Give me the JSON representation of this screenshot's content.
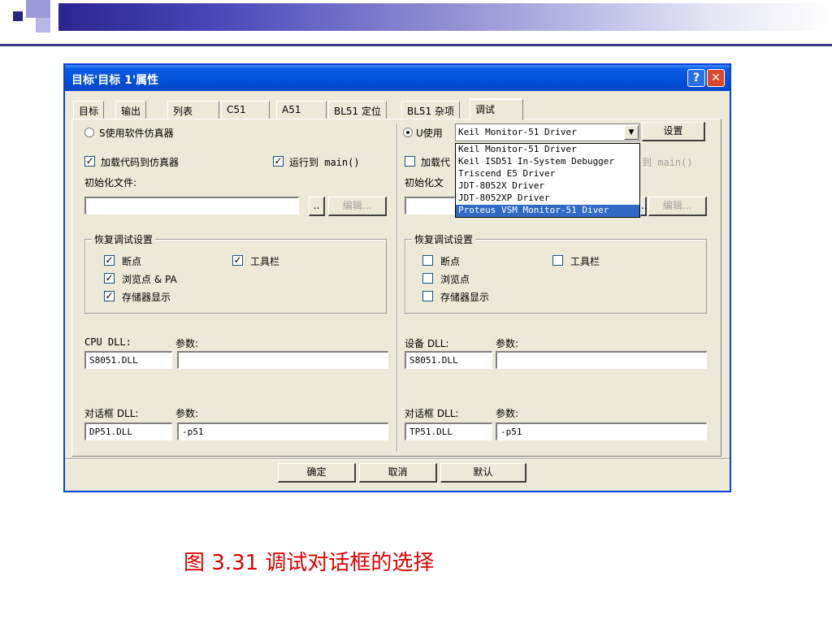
{
  "dialog": {
    "title": "目标'目标 1'属性",
    "help_label": "?",
    "close_label": "✕"
  },
  "tabs": [
    {
      "label": "目标"
    },
    {
      "label": "输出"
    },
    {
      "label": "列表"
    },
    {
      "label": "C51"
    },
    {
      "label": "A51"
    },
    {
      "label": "BL51 定位"
    },
    {
      "label": "BL51 杂项"
    },
    {
      "label": "调试",
      "active": true
    }
  ],
  "left": {
    "use_simulator_label": "S使用软件仿真器",
    "use_simulator_checked": false,
    "load_code_label": "加载代码到仿真器",
    "load_code_checked": true,
    "run_to_main_label": "运行到 main()",
    "run_to_main_checked": true,
    "init_file_label": "初始化文件:",
    "init_file_value": "",
    "browse_label": "..",
    "edit_label": "编辑...",
    "restore_group_title": "恢复调试设置",
    "restore": {
      "breakpoints": {
        "label": "断点",
        "checked": true
      },
      "toolbar": {
        "label": "工具栏",
        "checked": true
      },
      "watchpoints": {
        "label": "浏览点 & PA",
        "checked": true
      },
      "memory": {
        "label": "存储器显示",
        "checked": true
      }
    },
    "cpu_dll_label": "CPU DLL:",
    "cpu_param_label": "参数:",
    "cpu_dll_value": "S8051.DLL",
    "cpu_param_value": "",
    "dialog_dll_label": "对话框 DLL:",
    "dialog_param_label": "参数:",
    "dialog_dll_value": "DP51.DLL",
    "dialog_param_value": "-p51"
  },
  "right": {
    "use_label": "U使用",
    "use_checked": true,
    "driver_selected": "Keil Monitor-51 Driver",
    "settings_label": "设置",
    "load_code_label": "加载代",
    "load_code_checked": false,
    "run_to_main_label": "到 main()",
    "init_file_label": "初始化文",
    "init_file_value": "",
    "browse_label": "..",
    "edit_label": "编辑...",
    "restore_group_title": "恢复调试设置",
    "restore": {
      "breakpoints": {
        "label": "断点",
        "checked": false
      },
      "toolbar": {
        "label": "工具栏",
        "checked": false
      },
      "watchpoints": {
        "label": "浏览点",
        "checked": false
      },
      "memory": {
        "label": "存储器显示",
        "checked": false
      }
    },
    "device_dll_label": "设备 DLL:",
    "device_param_label": "参数:",
    "device_dll_value": "S8051.DLL",
    "device_param_value": "",
    "dialog_dll_label": "对话框 DLL:",
    "dialog_param_label": "参数:",
    "dialog_dll_value": "TP51.DLL",
    "dialog_param_value": "-p51"
  },
  "driver_options": [
    {
      "label": "Keil Monitor-51 Driver",
      "selected": false
    },
    {
      "label": "Keil ISD51 In-System Debugger",
      "selected": false
    },
    {
      "label": "Triscend E5 Driver",
      "selected": false
    },
    {
      "label": "JDT-8052X Driver",
      "selected": false
    },
    {
      "label": "JDT-8052XP Driver",
      "selected": false
    },
    {
      "label": "Proteus VSM Monitor-51 Diver",
      "selected": true
    }
  ],
  "buttons": {
    "ok": "确定",
    "cancel": "取消",
    "defaults": "默认"
  },
  "caption": "图 3.31 调试对话框的选择",
  "colors": {
    "header_accent": "#3b3590",
    "titlebar": "#0350d9",
    "caption": "#e00000",
    "selection": "#316ac5"
  }
}
